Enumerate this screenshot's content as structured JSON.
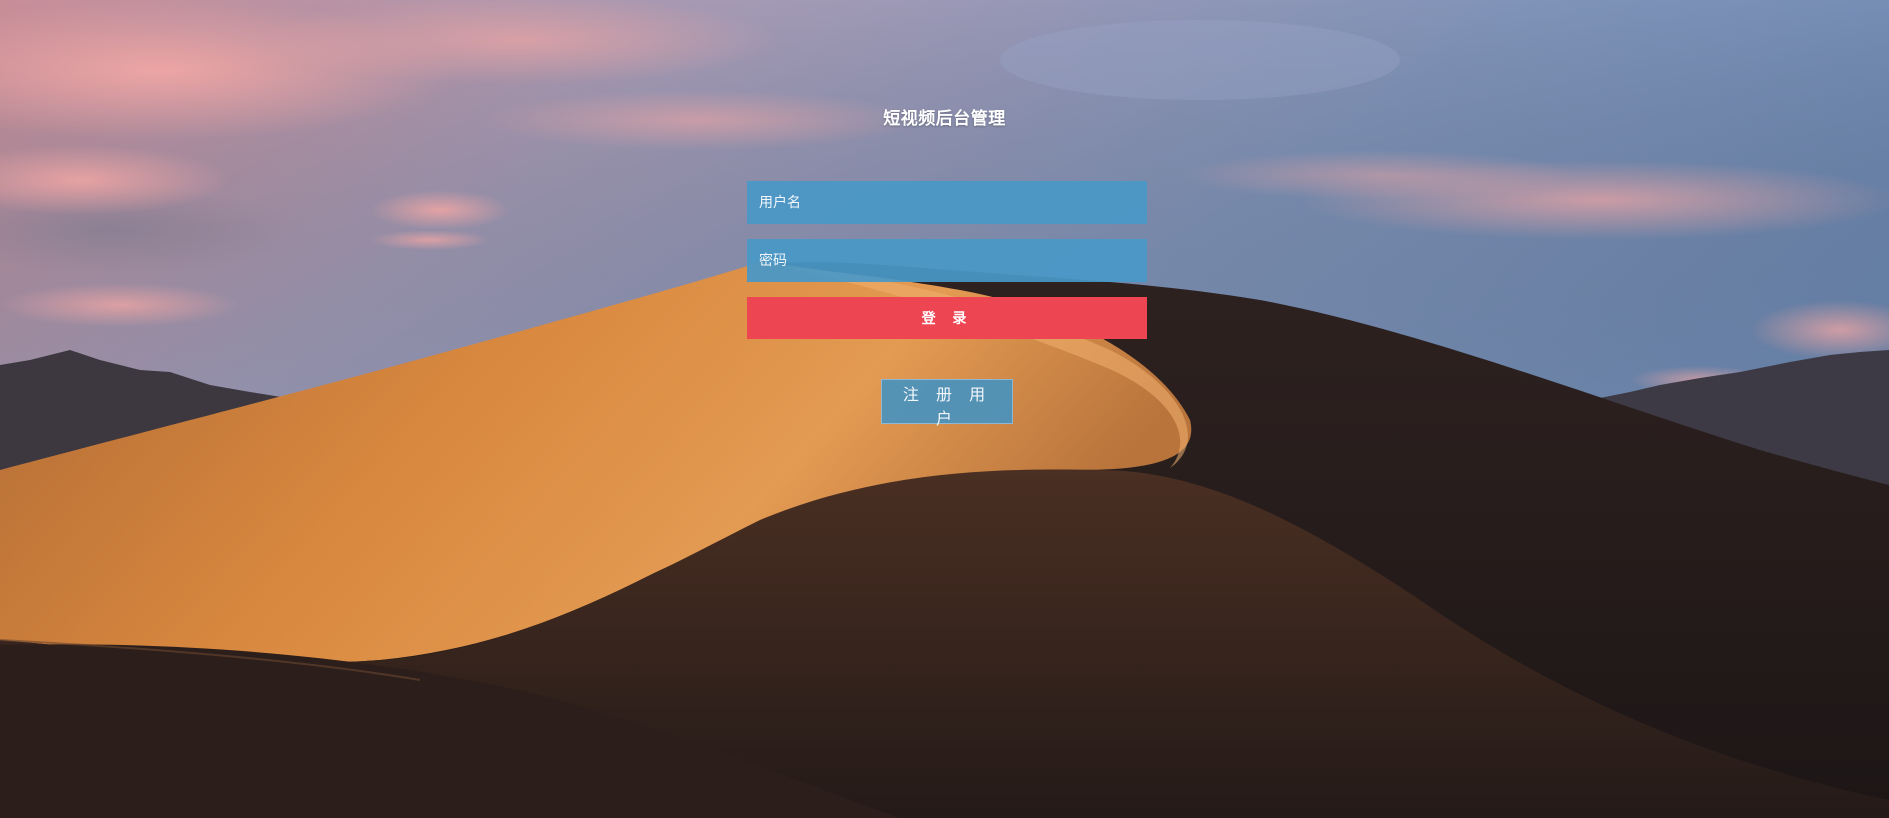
{
  "page": {
    "title": "短视频后台管理"
  },
  "form": {
    "username_placeholder": "用户名",
    "password_placeholder": "密码",
    "login_label": "登 录",
    "register_label": "注 册 用 户"
  },
  "colors": {
    "input_bg": "#4998c7",
    "login_bg": "#ee4552",
    "register_bg": "#4992be"
  }
}
